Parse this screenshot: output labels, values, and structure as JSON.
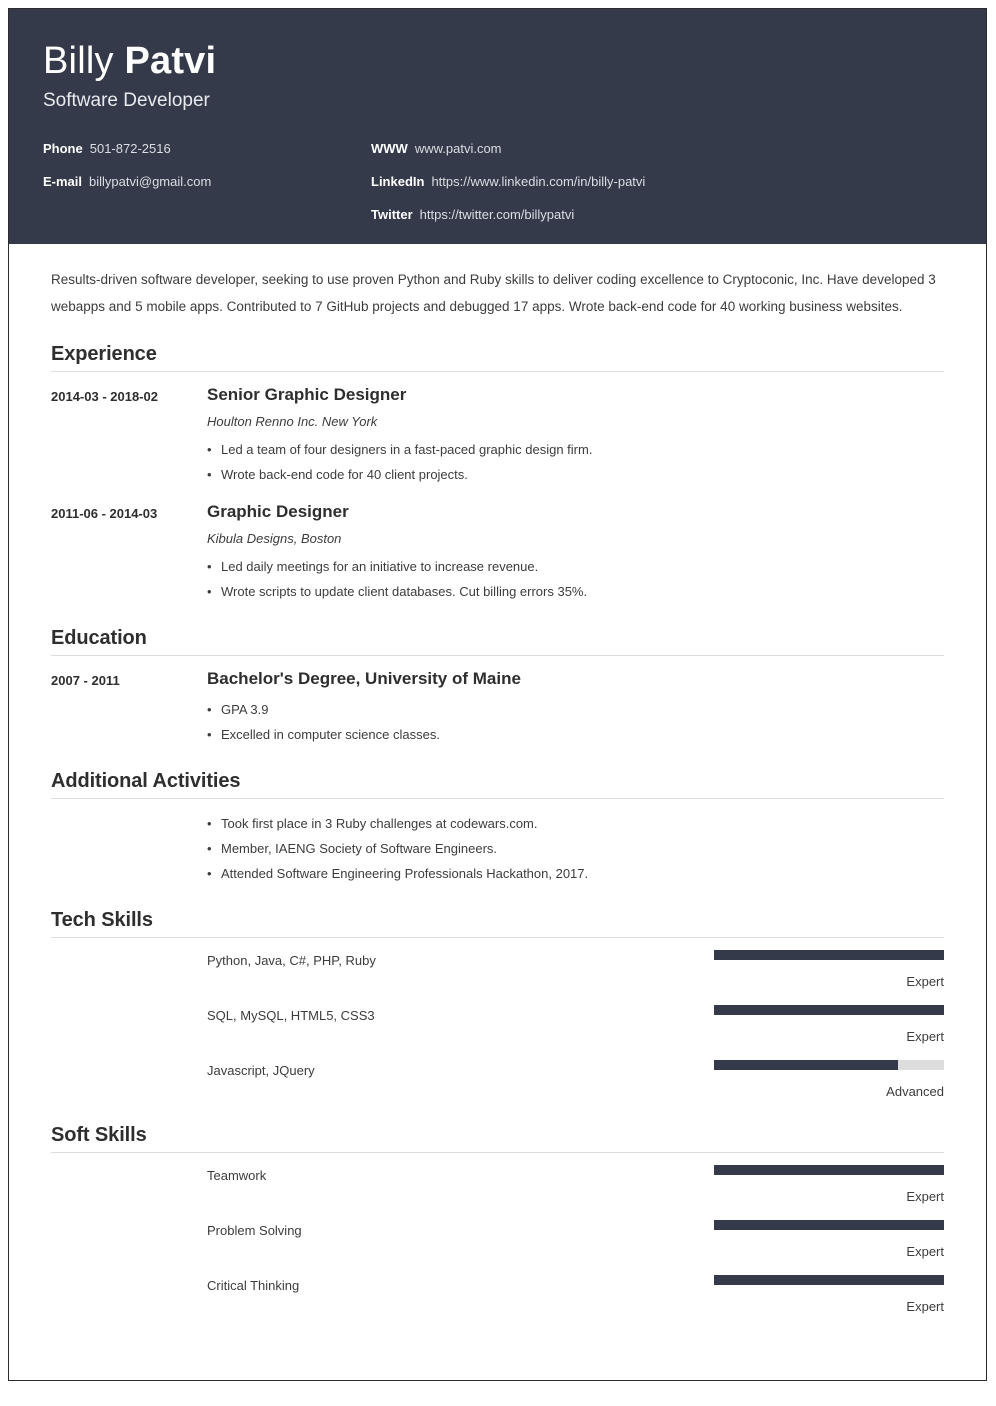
{
  "header": {
    "first_name": "Billy ",
    "last_name": "Patvi",
    "job_title": "Software Developer",
    "contacts_left": [
      {
        "label": "Phone",
        "value": "501-872-2516"
      },
      {
        "label": "E-mail",
        "value": "billypatvi@gmail.com"
      }
    ],
    "contacts_right": [
      {
        "label": "WWW",
        "value": "www.patvi.com"
      },
      {
        "label": "LinkedIn",
        "value": "https://www.linkedin.com/in/billy-patvi"
      },
      {
        "label": "Twitter",
        "value": "https://twitter.com/billypatvi"
      }
    ],
    "background_color": "#343a49"
  },
  "summary": "Results-driven software developer, seeking to use proven Python and Ruby skills to deliver coding excellence to Cryptoconic, Inc. Have developed 3 webapps and 5 mobile apps. Contributed to 7 GitHub projects and debugged 17 apps. Wrote back-end code for 40 working business websites.",
  "sections": {
    "experience": {
      "title": "Experience",
      "entries": [
        {
          "date": "2014-03 - 2018-02",
          "title": "Senior Graphic Designer",
          "subtitle": "Houlton Renno Inc. New York",
          "bullets": [
            "Led a team of four designers in a fast-paced graphic design firm.",
            "Wrote back-end code for 40 client projects."
          ]
        },
        {
          "date": "2011-06 - 2014-03",
          "title": "Graphic Designer",
          "subtitle": "Kibula Designs, Boston",
          "bullets": [
            "Led daily meetings for an initiative to increase revenue.",
            "Wrote scripts to update client databases. Cut billing errors 35%."
          ]
        }
      ]
    },
    "education": {
      "title": "Education",
      "entries": [
        {
          "date": "2007 - 2011",
          "title": "Bachelor's Degree, University of Maine",
          "bullets": [
            "GPA 3.9",
            "Excelled in computer science classes."
          ]
        }
      ]
    },
    "additional_activities": {
      "title": "Additional Activities",
      "bullets": [
        "Took first place in 3 Ruby challenges at codewars.com.",
        "Member, IAENG Society of Software Engineers.",
        "Attended Software Engineering Professionals Hackathon, 2017."
      ]
    },
    "tech_skills": {
      "title": "Tech Skills",
      "skills": [
        {
          "name": "Python, Java, C#, PHP, Ruby",
          "level": "Expert",
          "percent": 100
        },
        {
          "name": "SQL, MySQL, HTML5, CSS3",
          "level": "Expert",
          "percent": 100
        },
        {
          "name": "Javascript, JQuery",
          "level": "Advanced",
          "percent": 80
        }
      ]
    },
    "soft_skills": {
      "title": "Soft Skills",
      "skills": [
        {
          "name": "Teamwork",
          "level": "Expert",
          "percent": 100
        },
        {
          "name": "Problem Solving",
          "level": "Expert",
          "percent": 100
        },
        {
          "name": "Critical Thinking",
          "level": "Expert",
          "percent": 100
        }
      ]
    }
  },
  "colors": {
    "header_bg": "#343a49",
    "bar_fill": "#343a49",
    "bar_track": "#dddddd",
    "rule": "#dcdcdc",
    "text": "#3c3c3c"
  }
}
